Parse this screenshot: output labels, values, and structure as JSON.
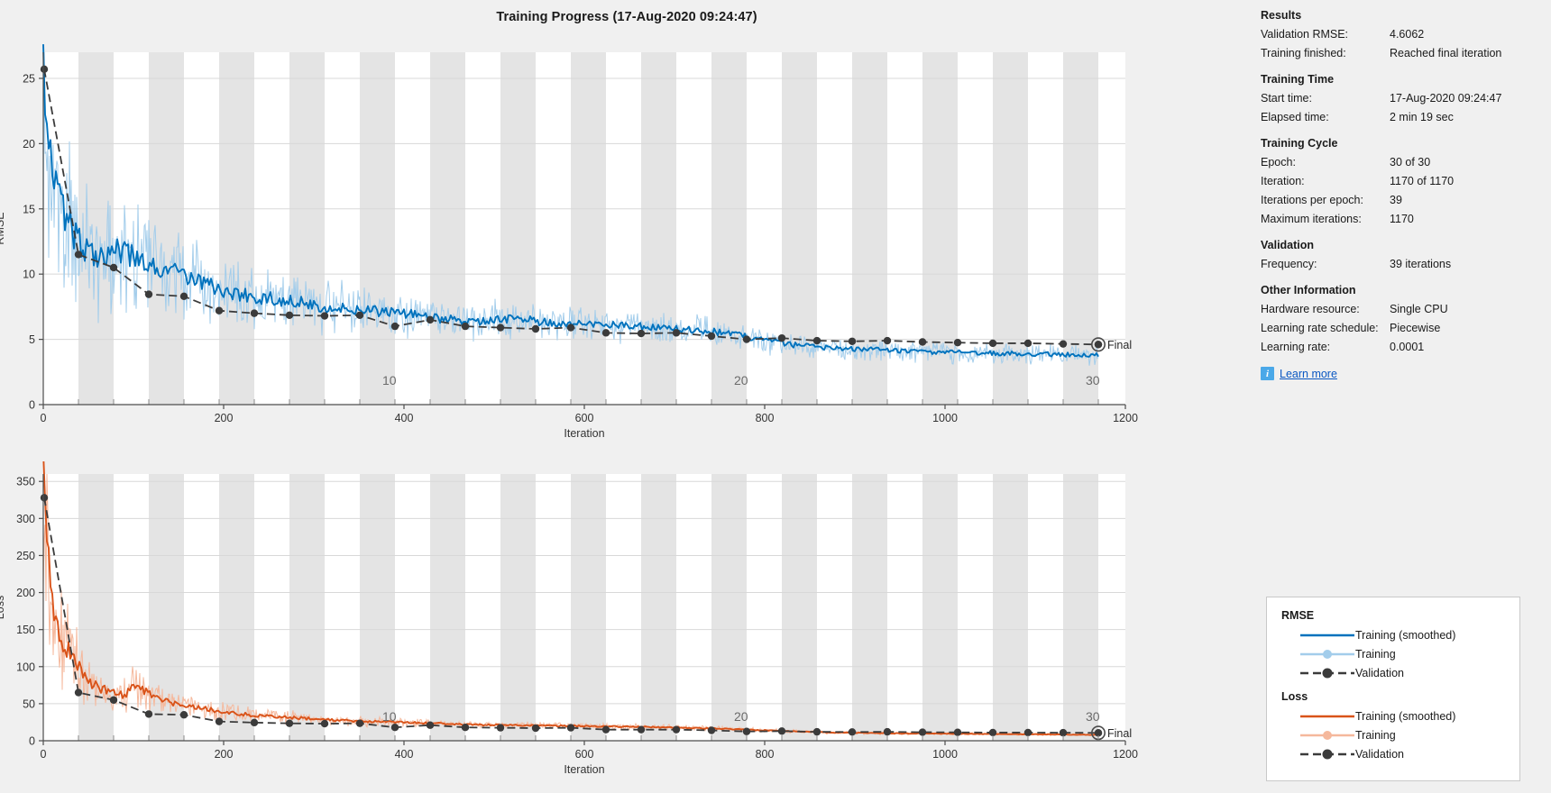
{
  "window": {
    "title": "Training Progress (17-Aug-2020 09:24:47)",
    "background": "#f0f0f0"
  },
  "colors": {
    "rmse_smoothed": "#0072bd",
    "rmse_raw": "#a3cdeb",
    "loss_smoothed": "#d95319",
    "loss_raw": "#f5b89c",
    "validation": "#3b3b3b",
    "band": "#e4e4e4",
    "link": "#0a57c2",
    "info_icon": "#4aa8e8"
  },
  "info": {
    "sections": [
      {
        "id": "results",
        "title": "Results",
        "rows": [
          {
            "key": "Validation RMSE:",
            "value": "4.6062"
          },
          {
            "key": "Training finished:",
            "value": "Reached final iteration"
          }
        ]
      },
      {
        "id": "training-time",
        "title": "Training Time",
        "rows": [
          {
            "key": "Start time:",
            "value": "17-Aug-2020 09:24:47"
          },
          {
            "key": "Elapsed time:",
            "value": "2 min 19 sec"
          }
        ]
      },
      {
        "id": "training-cycle",
        "title": "Training Cycle",
        "rows": [
          {
            "key": "Epoch:",
            "value": "30 of 30"
          },
          {
            "key": "Iteration:",
            "value": "1170 of 1170"
          },
          {
            "key": "Iterations per epoch:",
            "value": "39"
          },
          {
            "key": "Maximum iterations:",
            "value": "1170"
          }
        ]
      },
      {
        "id": "validation",
        "title": "Validation",
        "rows": [
          {
            "key": "Frequency:",
            "value": "39 iterations"
          }
        ]
      },
      {
        "id": "other-information",
        "title": "Other Information",
        "rows": [
          {
            "key": "Hardware resource:",
            "value": "Single CPU"
          },
          {
            "key": "Learning rate schedule:",
            "value": "Piecewise"
          },
          {
            "key": "Learning rate:",
            "value": "0.0001"
          }
        ]
      }
    ],
    "learn_more": {
      "icon": "info-icon",
      "icon_glyph": "i",
      "label": "Learn more"
    }
  },
  "legend": {
    "groups": [
      {
        "title": "RMSE",
        "entries": [
          {
            "label": "Training (smoothed)",
            "style": "solid",
            "color": "#0072bd",
            "marker": false
          },
          {
            "label": "Training",
            "style": "solid",
            "color": "#a3cdeb",
            "marker": true
          },
          {
            "label": "Validation",
            "style": "dashed",
            "color": "#3b3b3b",
            "marker": true
          }
        ]
      },
      {
        "title": "Loss",
        "entries": [
          {
            "label": "Training (smoothed)",
            "style": "solid",
            "color": "#d95319",
            "marker": false
          },
          {
            "label": "Training",
            "style": "solid",
            "color": "#f5b89c",
            "marker": true
          },
          {
            "label": "Validation",
            "style": "dashed",
            "color": "#3b3b3b",
            "marker": true
          }
        ]
      }
    ]
  },
  "chart_data": [
    {
      "id": "rmse-chart",
      "type": "line",
      "title": "RMSE",
      "xlabel": "Iteration",
      "ylabel": "RMSE",
      "xlim": [
        0,
        1200
      ],
      "ylim": [
        0,
        27
      ],
      "xticks": [
        0,
        200,
        400,
        600,
        800,
        1000,
        1200
      ],
      "yticks": [
        0,
        5,
        10,
        15,
        20,
        25
      ],
      "grid": true,
      "epoch_bands": {
        "iterations_per_epoch": 39,
        "epochs": 30,
        "shaded": "odd"
      },
      "epoch_tick_labels": [
        {
          "epoch": 10,
          "iteration": 390
        },
        {
          "epoch": 20,
          "iteration": 780
        },
        {
          "epoch": 30,
          "iteration": 1170
        }
      ],
      "final_label": "Final",
      "series": [
        {
          "name": "Validation",
          "style": "dashed-markers",
          "color": "#3b3b3b",
          "x": [
            1,
            39,
            78,
            117,
            156,
            195,
            234,
            273,
            312,
            351,
            390,
            429,
            468,
            507,
            546,
            585,
            624,
            663,
            702,
            741,
            780,
            819,
            858,
            897,
            936,
            975,
            1014,
            1053,
            1092,
            1131,
            1170
          ],
          "y": [
            25.7,
            11.5,
            10.5,
            8.45,
            8.3,
            7.2,
            7.0,
            6.85,
            6.8,
            6.85,
            6.0,
            6.5,
            6.0,
            5.9,
            5.8,
            5.9,
            5.5,
            5.45,
            5.5,
            5.25,
            5.0,
            5.1,
            4.9,
            4.85,
            4.9,
            4.8,
            4.75,
            4.7,
            4.7,
            4.65,
            4.6062
          ]
        },
        {
          "name": "Training (smoothed)",
          "style": "solid",
          "color": "#0072bd",
          "description": "Smoothed per-iteration training RMSE decaying from ~26.5 at iteration 0 to ~3.8 at iteration 1170",
          "anchors_x": [
            0,
            10,
            25,
            40,
            60,
            80,
            100,
            120,
            140,
            160,
            180,
            200,
            240,
            280,
            320,
            360,
            400,
            440,
            480,
            520,
            560,
            600,
            640,
            680,
            720,
            760,
            800,
            840,
            880,
            920,
            960,
            1000,
            1040,
            1080,
            1120,
            1170
          ],
          "anchors_y": [
            26.5,
            18.0,
            14.2,
            12.3,
            11.6,
            11.8,
            11.2,
            10.6,
            10.2,
            9.8,
            9.4,
            8.6,
            8.2,
            7.9,
            7.4,
            7.2,
            7.0,
            6.6,
            6.4,
            6.6,
            6.3,
            6.2,
            6.1,
            5.9,
            5.7,
            5.5,
            4.9,
            4.5,
            4.3,
            4.2,
            4.1,
            4.0,
            3.95,
            3.9,
            3.85,
            3.8
          ]
        },
        {
          "name": "Training",
          "style": "noisy",
          "color": "#a3cdeb",
          "description": "Raw per-iteration training RMSE, noise envelope around the smoothed curve"
        }
      ]
    },
    {
      "id": "loss-chart",
      "type": "line",
      "title": "Loss",
      "xlabel": "Iteration",
      "ylabel": "Loss",
      "xlim": [
        0,
        1200
      ],
      "ylim": [
        0,
        360
      ],
      "xticks": [
        0,
        200,
        400,
        600,
        800,
        1000,
        1200
      ],
      "yticks": [
        0,
        50,
        100,
        150,
        200,
        250,
        300,
        350
      ],
      "grid": true,
      "epoch_bands": {
        "iterations_per_epoch": 39,
        "epochs": 30,
        "shaded": "odd"
      },
      "epoch_tick_labels": [
        {
          "epoch": 10,
          "iteration": 390
        },
        {
          "epoch": 20,
          "iteration": 780
        },
        {
          "epoch": 30,
          "iteration": 1170
        }
      ],
      "final_label": "Final",
      "series": [
        {
          "name": "Validation",
          "style": "dashed-markers",
          "color": "#3b3b3b",
          "x": [
            1,
            39,
            78,
            117,
            156,
            195,
            234,
            273,
            312,
            351,
            390,
            429,
            468,
            507,
            546,
            585,
            624,
            663,
            702,
            741,
            780,
            819,
            858,
            897,
            936,
            975,
            1014,
            1053,
            1092,
            1131,
            1170
          ],
          "y": [
            328,
            65,
            55,
            36,
            35,
            26,
            24.5,
            23.5,
            23,
            23.5,
            18,
            21,
            18,
            17.5,
            17,
            17.5,
            15,
            15,
            15,
            14,
            12.5,
            13,
            12,
            11.8,
            12,
            11.5,
            11.3,
            11,
            11,
            10.8,
            10.6
          ]
        },
        {
          "name": "Training (smoothed)",
          "style": "solid",
          "color": "#d95319",
          "description": "Smoothed per-iteration training loss decaying from ~352 at iteration 0 to ~8 at iteration 1170",
          "anchors_x": [
            0,
            8,
            16,
            24,
            32,
            40,
            50,
            60,
            70,
            80,
            90,
            100,
            110,
            120,
            140,
            160,
            180,
            200,
            240,
            280,
            320,
            360,
            400,
            460,
            520,
            580,
            640,
            700,
            760,
            820,
            880,
            940,
            1000,
            1060,
            1120,
            1170
          ],
          "anchors_y": [
            352,
            210,
            150,
            128,
            120,
            100,
            82,
            72,
            68,
            66,
            62,
            72,
            70,
            62,
            52,
            48,
            44,
            38,
            34,
            31,
            28,
            26,
            25,
            22,
            21,
            20,
            19,
            18,
            16,
            13,
            11,
            10,
            9.5,
            9,
            8.5,
            8
          ]
        },
        {
          "name": "Training",
          "style": "noisy",
          "color": "#f5b89c",
          "description": "Raw per-iteration training loss, noise envelope around the smoothed curve"
        }
      ]
    }
  ]
}
